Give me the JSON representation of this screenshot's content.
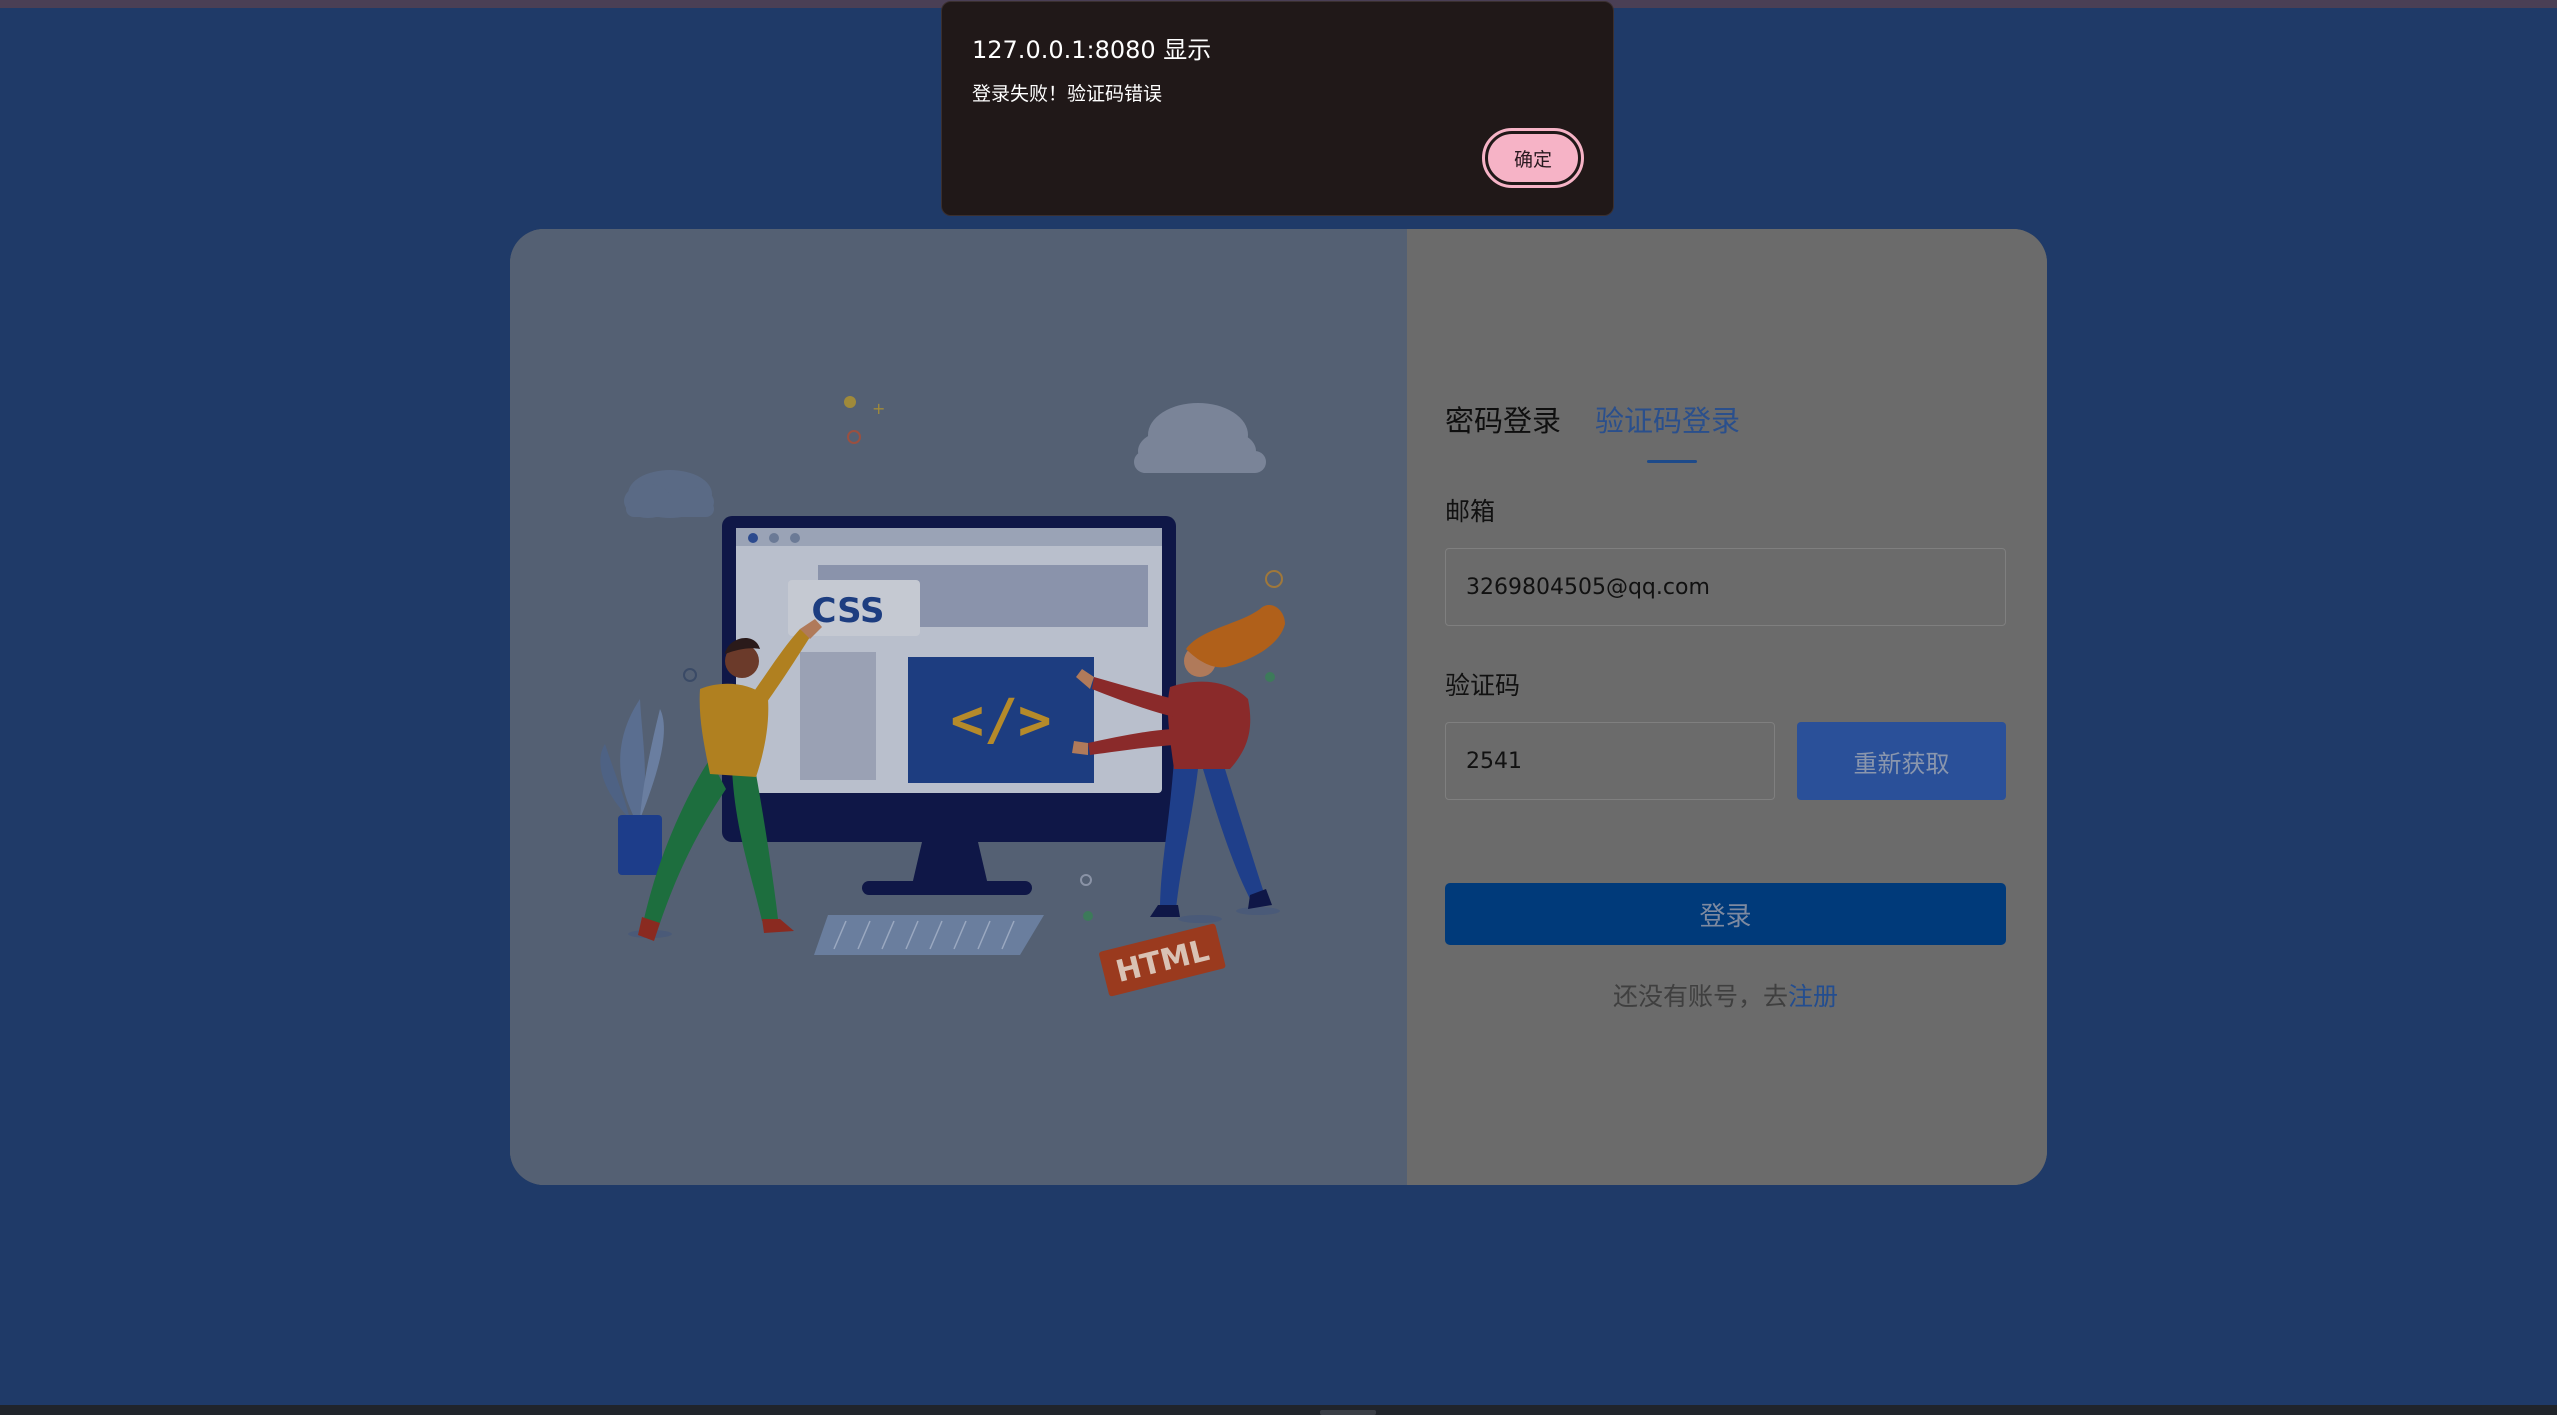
{
  "dialog": {
    "title": "127.0.0.1:8080 显示",
    "message": "登录失败！验证码错误",
    "ok_label": "确定"
  },
  "login": {
    "tabs": [
      {
        "label": "密码登录",
        "active": false
      },
      {
        "label": "验证码登录",
        "active": true
      }
    ],
    "email_label": "邮箱",
    "email_value": "3269804505@qq.com",
    "code_label": "验证码",
    "code_value": "2541",
    "resend_label": "重新获取",
    "submit_label": "登录",
    "register_prompt": "还没有账号，去",
    "register_link": "注册"
  },
  "illustration": {
    "css_text": "CSS",
    "code_text": "</>",
    "html_text": "HTML"
  },
  "colors": {
    "page_bg": "#1f3a68",
    "accent": "#2a5099",
    "dialog_ok": "#f6b3c6"
  }
}
